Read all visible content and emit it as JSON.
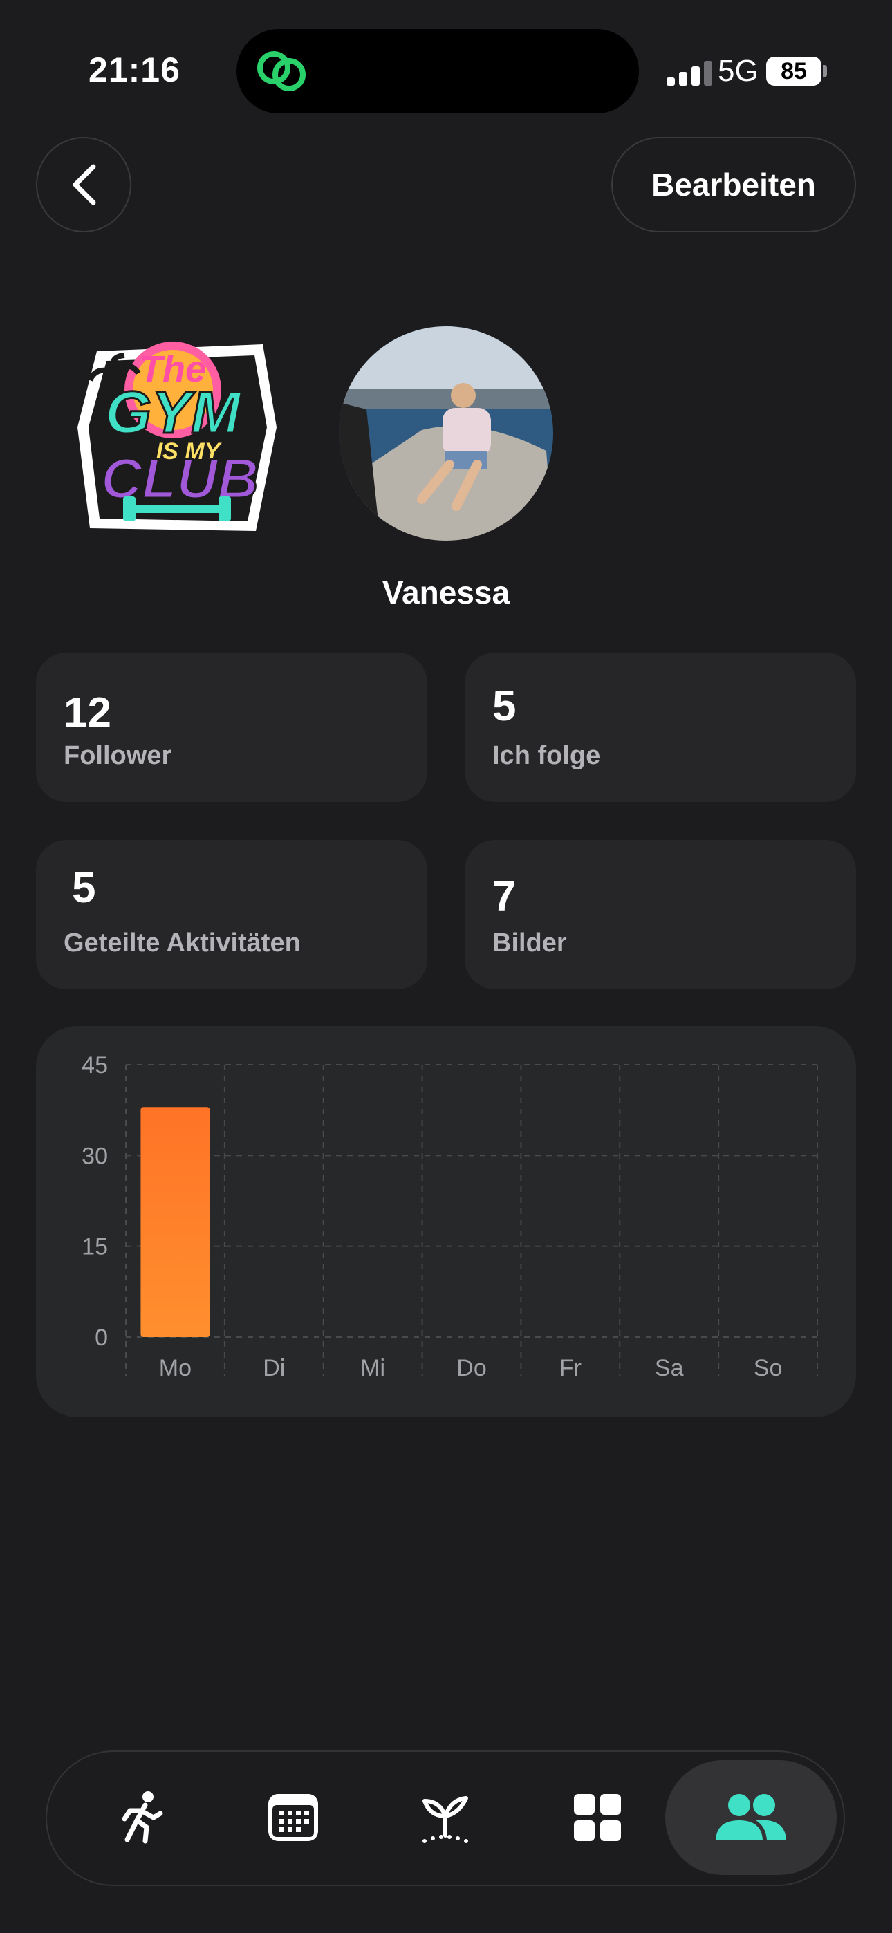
{
  "status_bar": {
    "time": "21:16",
    "network": "5G",
    "battery": "85"
  },
  "header": {
    "edit_label": "Bearbeiten"
  },
  "profile": {
    "sticker_text": [
      "The",
      "GYM",
      "IS MY",
      "CLUB"
    ],
    "name": "Vanessa"
  },
  "stats": [
    {
      "value": "12",
      "label": "Follower"
    },
    {
      "value": "5",
      "label": "Ich folge"
    },
    {
      "value": "5",
      "label": "Geteilte Aktivitäten"
    },
    {
      "value": "7",
      "label": "Bilder"
    }
  ],
  "colors": {
    "accent": "#3fe0c5",
    "bar": "#ff7b29",
    "status_green": "#2ad06a"
  },
  "chart_data": {
    "type": "bar",
    "categories": [
      "Mo",
      "Di",
      "Mi",
      "Do",
      "Fr",
      "Sa",
      "So"
    ],
    "values": [
      38,
      0,
      0,
      0,
      0,
      0,
      0
    ],
    "ylim": [
      0,
      45
    ],
    "yticks": [
      "0",
      "15",
      "30",
      "45"
    ],
    "grid": true
  },
  "tabbar": {
    "items": [
      "run-icon",
      "calendar-icon",
      "sprout-icon",
      "grid-icon",
      "people-icon"
    ],
    "active": "people-icon"
  }
}
